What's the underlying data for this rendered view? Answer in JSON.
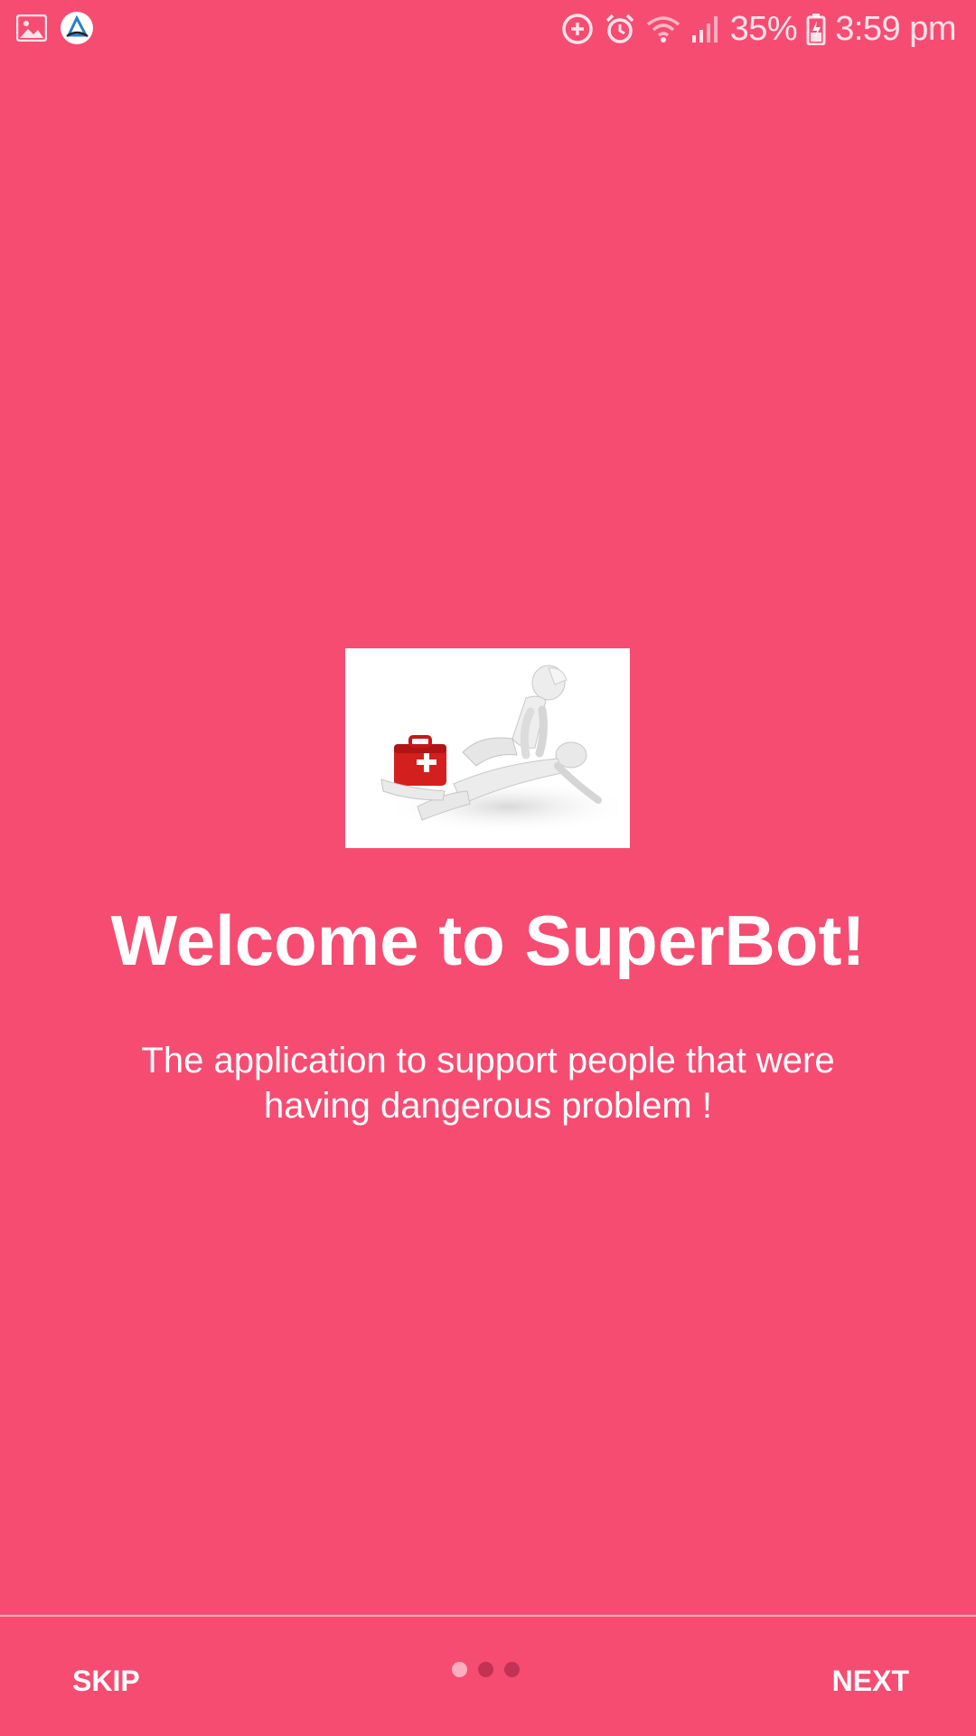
{
  "status_bar": {
    "battery": "35%",
    "time": "3:59 pm",
    "icons": [
      "gallery-icon",
      "app-logo-icon",
      "add-circle-icon",
      "alarm-icon",
      "wifi-icon",
      "signal-icon",
      "battery-charging-icon"
    ]
  },
  "onboarding": {
    "image": "cpr-first-aid-illustration",
    "title": "Welcome to SuperBot!",
    "description": "The application to support people that were having dangerous problem !"
  },
  "footer": {
    "skip_label": "SKIP",
    "next_label": "NEXT",
    "page_count": 3,
    "current_page": 1
  },
  "colors": {
    "background": "#f64c72",
    "text": "#ffffff"
  }
}
